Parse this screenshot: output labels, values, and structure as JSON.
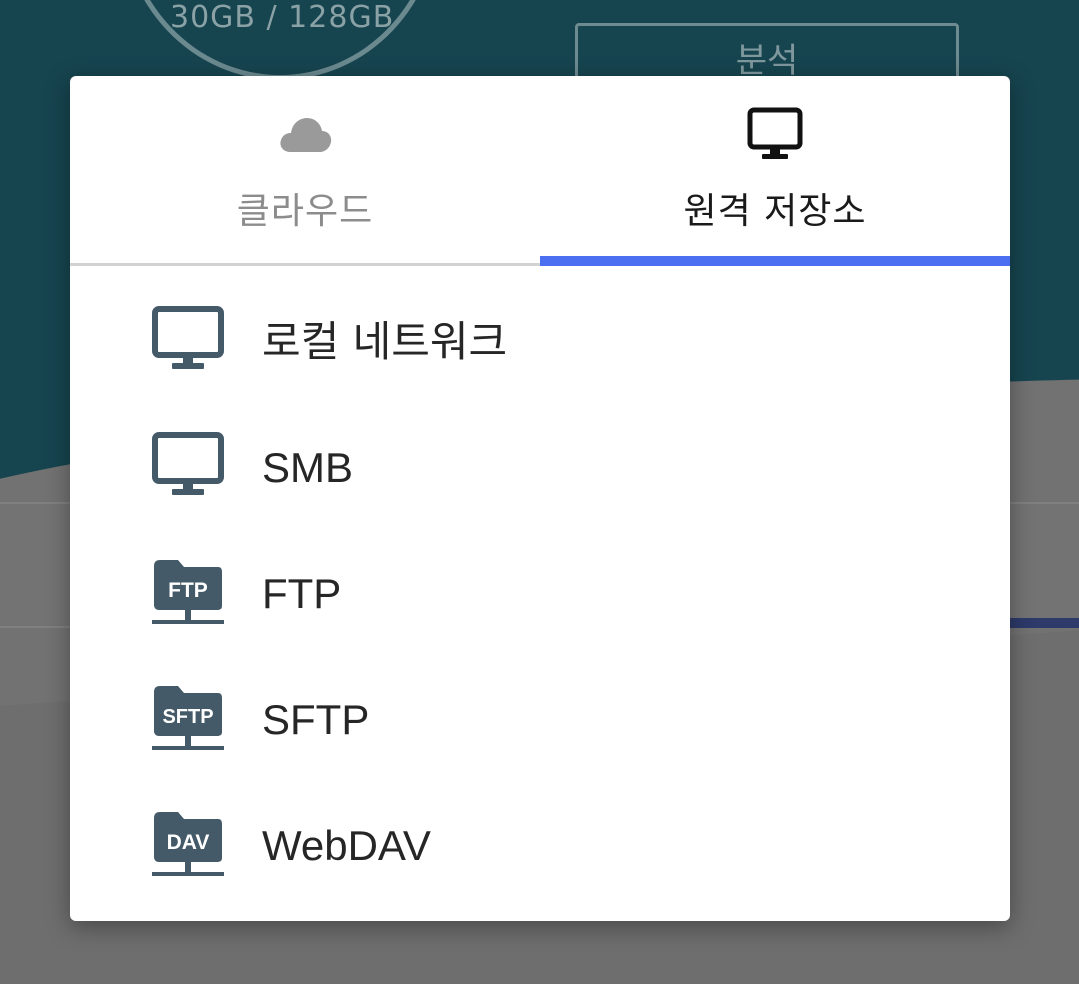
{
  "background": {
    "storage_text": "30GB / 128GB",
    "analyze_button": "분석"
  },
  "tabs": [
    {
      "label": "클라우드",
      "icon": "cloud-icon",
      "active": false
    },
    {
      "label": "원격 저장소",
      "icon": "monitor-icon",
      "active": true
    }
  ],
  "options": [
    {
      "label": "로컬 네트워크",
      "icon": "monitor-icon"
    },
    {
      "label": "SMB",
      "icon": "monitor-icon"
    },
    {
      "label": "FTP",
      "icon": "network-folder-icon",
      "badge": "FTP"
    },
    {
      "label": "SFTP",
      "icon": "network-folder-icon",
      "badge": "SFTP"
    },
    {
      "label": "WebDAV",
      "icon": "network-folder-icon",
      "badge": "DAV"
    }
  ],
  "colors": {
    "accent": "#4c6ef0",
    "icon": "#455a68",
    "header_bg": "#16444f"
  }
}
